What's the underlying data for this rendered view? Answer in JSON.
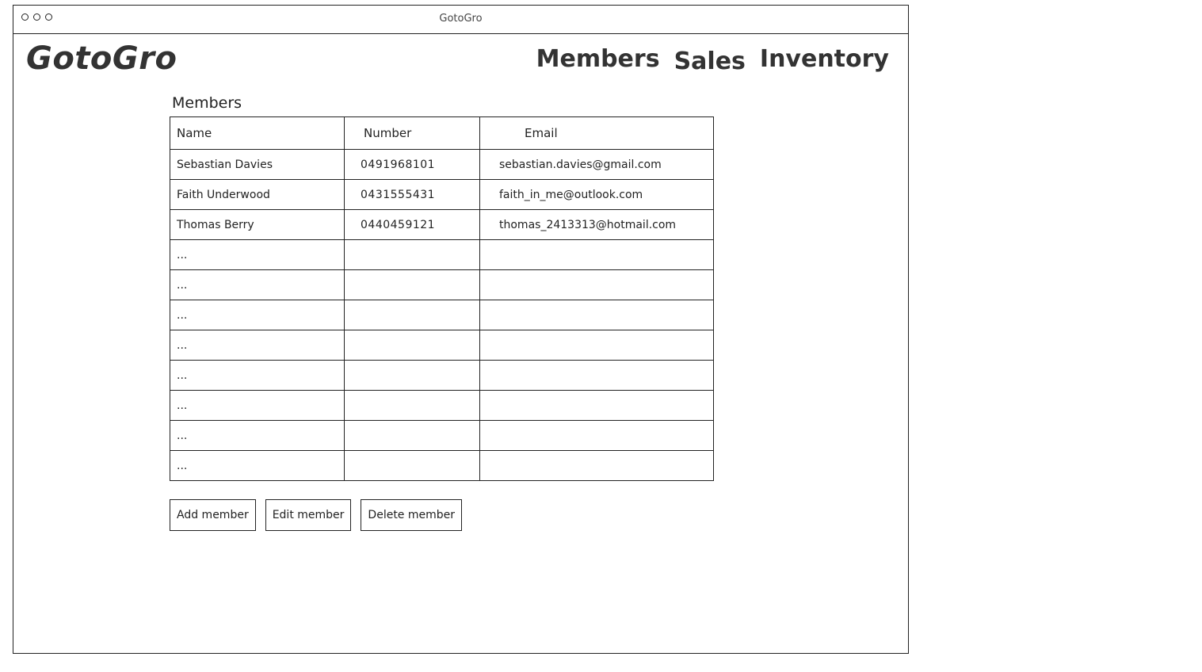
{
  "window": {
    "title": "GotoGro"
  },
  "header": {
    "logo": "GotoGro",
    "nav": [
      {
        "label": "Members"
      },
      {
        "label": "Sales"
      },
      {
        "label": "Inventory"
      }
    ]
  },
  "main": {
    "section_title": "Members",
    "table": {
      "columns": [
        "Name",
        "Number",
        "Email"
      ],
      "rows": [
        {
          "name": "Sebastian Davies",
          "number": "0491968101",
          "email": "sebastian.davies@gmail.com"
        },
        {
          "name": "Faith Underwood",
          "number": "0431555431",
          "email": "faith_in_me@outlook.com"
        },
        {
          "name": "Thomas Berry",
          "number": "0440459121",
          "email": "thomas_2413313@hotmail.com"
        },
        {
          "name": "...",
          "number": "",
          "email": ""
        },
        {
          "name": "...",
          "number": "",
          "email": ""
        },
        {
          "name": "...",
          "number": "",
          "email": ""
        },
        {
          "name": "...",
          "number": "",
          "email": ""
        },
        {
          "name": "...",
          "number": "",
          "email": ""
        },
        {
          "name": "...",
          "number": "",
          "email": ""
        },
        {
          "name": "...",
          "number": "",
          "email": ""
        },
        {
          "name": "...",
          "number": "",
          "email": ""
        }
      ]
    },
    "buttons": {
      "add": "Add member",
      "edit": "Edit member",
      "delete": "Delete member"
    }
  }
}
